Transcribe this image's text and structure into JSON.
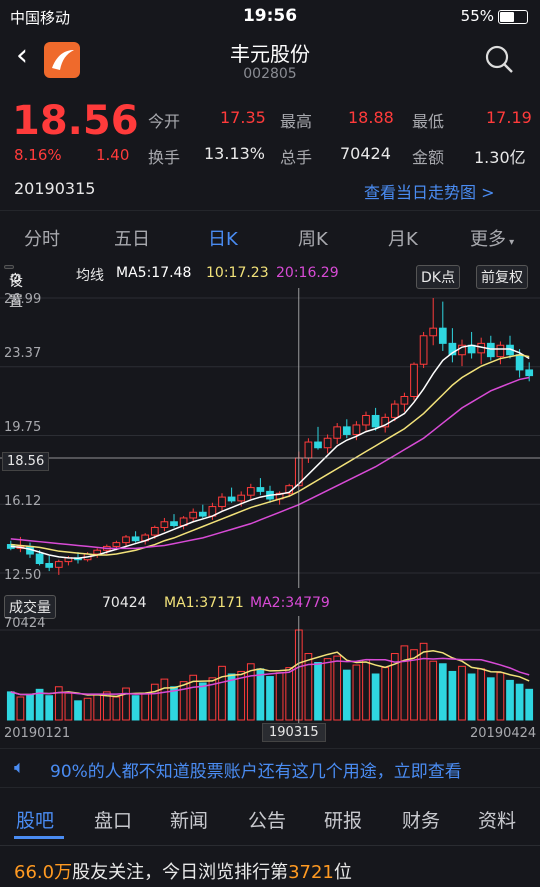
{
  "status": {
    "carrier": "中国移动",
    "time": "19:56",
    "battery": "55%"
  },
  "header": {
    "name": "丰元股份",
    "code": "002805"
  },
  "quote": {
    "price": "18.56",
    "change_pct": "8.16%",
    "change": "1.40",
    "date": "20190315",
    "open_label": "今开",
    "open": "17.35",
    "high_label": "最高",
    "high": "18.88",
    "low_label": "最低",
    "low": "17.19",
    "turnover_label": "换手",
    "turnover": "13.13%",
    "volume_label": "总手",
    "volume": "70424",
    "amount_label": "金额",
    "amount": "1.30亿",
    "link": "查看当日走势图 >"
  },
  "tabs": [
    "分时",
    "五日",
    "日K",
    "周K",
    "月K",
    "更多"
  ],
  "chart_toolbar": {
    "settings": "设置",
    "ma_label": "均线",
    "ma5": "MA5:17.48",
    "ma10": "10:17.23",
    "ma20": "20:16.29",
    "dk": "DK点",
    "adjust": "前复权"
  },
  "volume_toolbar": {
    "label": "成交量",
    "vol": "70424",
    "ma1": "MA1:37171",
    "ma2": "MA2:34779"
  },
  "colors": {
    "up": "#ff3b3b",
    "down": "#2fd6e0",
    "ma5": "#ffffff",
    "ma10": "#f2e27a",
    "ma20": "#d84bd6",
    "accent": "#4a8cf2"
  },
  "chart_data": {
    "type": "candlestick",
    "y_ticks": [
      "26.99",
      "23.37",
      "19.75",
      "16.12",
      "12.50"
    ],
    "ylim": [
      12.5,
      26.99
    ],
    "crosshair_value": "18.56",
    "crosshair_date": "190315",
    "x_start": "20190121",
    "x_end": "20190424",
    "volume_max": "70424",
    "candles": [
      {
        "o": 14.0,
        "h": 14.2,
        "l": 13.7,
        "c": 13.8
      },
      {
        "o": 13.8,
        "h": 14.4,
        "l": 13.6,
        "c": 13.9
      },
      {
        "o": 13.9,
        "h": 14.1,
        "l": 13.3,
        "c": 13.5
      },
      {
        "o": 13.5,
        "h": 13.7,
        "l": 12.9,
        "c": 13.0
      },
      {
        "o": 13.0,
        "h": 13.4,
        "l": 12.6,
        "c": 12.8
      },
      {
        "o": 12.8,
        "h": 13.2,
        "l": 12.4,
        "c": 13.1
      },
      {
        "o": 13.1,
        "h": 13.4,
        "l": 12.9,
        "c": 13.3
      },
      {
        "o": 13.3,
        "h": 13.6,
        "l": 13.0,
        "c": 13.2
      },
      {
        "o": 13.2,
        "h": 13.6,
        "l": 13.1,
        "c": 13.5
      },
      {
        "o": 13.5,
        "h": 13.8,
        "l": 13.3,
        "c": 13.7
      },
      {
        "o": 13.7,
        "h": 14.0,
        "l": 13.5,
        "c": 13.9
      },
      {
        "o": 13.9,
        "h": 14.2,
        "l": 13.7,
        "c": 14.1
      },
      {
        "o": 14.1,
        "h": 14.5,
        "l": 13.9,
        "c": 14.4
      },
      {
        "o": 14.4,
        "h": 14.7,
        "l": 14.1,
        "c": 14.2
      },
      {
        "o": 14.2,
        "h": 14.6,
        "l": 14.0,
        "c": 14.5
      },
      {
        "o": 14.5,
        "h": 15.0,
        "l": 14.3,
        "c": 14.9
      },
      {
        "o": 14.9,
        "h": 15.4,
        "l": 14.7,
        "c": 15.2
      },
      {
        "o": 15.2,
        "h": 15.6,
        "l": 14.9,
        "c": 15.0
      },
      {
        "o": 15.0,
        "h": 15.5,
        "l": 14.8,
        "c": 15.4
      },
      {
        "o": 15.4,
        "h": 15.9,
        "l": 15.2,
        "c": 15.7
      },
      {
        "o": 15.7,
        "h": 16.1,
        "l": 15.4,
        "c": 15.5
      },
      {
        "o": 15.5,
        "h": 16.2,
        "l": 15.3,
        "c": 16.0
      },
      {
        "o": 16.0,
        "h": 16.7,
        "l": 15.8,
        "c": 16.5
      },
      {
        "o": 16.5,
        "h": 17.0,
        "l": 16.2,
        "c": 16.3
      },
      {
        "o": 16.3,
        "h": 16.8,
        "l": 16.0,
        "c": 16.6
      },
      {
        "o": 16.6,
        "h": 17.2,
        "l": 16.4,
        "c": 17.0
      },
      {
        "o": 17.0,
        "h": 17.5,
        "l": 16.6,
        "c": 16.8
      },
      {
        "o": 16.8,
        "h": 17.1,
        "l": 16.2,
        "c": 16.4
      },
      {
        "o": 16.4,
        "h": 16.8,
        "l": 16.1,
        "c": 16.7
      },
      {
        "o": 16.7,
        "h": 17.2,
        "l": 16.5,
        "c": 17.1
      },
      {
        "o": 17.1,
        "h": 18.9,
        "l": 17.2,
        "c": 18.56
      },
      {
        "o": 18.56,
        "h": 19.6,
        "l": 18.3,
        "c": 19.4
      },
      {
        "o": 19.4,
        "h": 20.2,
        "l": 19.0,
        "c": 19.1
      },
      {
        "o": 19.1,
        "h": 19.8,
        "l": 18.8,
        "c": 19.6
      },
      {
        "o": 19.6,
        "h": 20.4,
        "l": 19.3,
        "c": 20.2
      },
      {
        "o": 20.2,
        "h": 20.6,
        "l": 19.6,
        "c": 19.8
      },
      {
        "o": 19.8,
        "h": 20.5,
        "l": 19.5,
        "c": 20.3
      },
      {
        "o": 20.3,
        "h": 21.0,
        "l": 20.0,
        "c": 20.8
      },
      {
        "o": 20.8,
        "h": 21.2,
        "l": 20.0,
        "c": 20.2
      },
      {
        "o": 20.2,
        "h": 20.9,
        "l": 19.9,
        "c": 20.7
      },
      {
        "o": 20.7,
        "h": 21.6,
        "l": 20.5,
        "c": 21.4
      },
      {
        "o": 21.4,
        "h": 22.0,
        "l": 21.0,
        "c": 21.8
      },
      {
        "o": 21.8,
        "h": 23.6,
        "l": 21.6,
        "c": 23.5
      },
      {
        "o": 23.5,
        "h": 25.2,
        "l": 23.3,
        "c": 25.0
      },
      {
        "o": 25.0,
        "h": 26.99,
        "l": 24.5,
        "c": 25.4
      },
      {
        "o": 25.4,
        "h": 26.8,
        "l": 24.2,
        "c": 24.6
      },
      {
        "o": 24.6,
        "h": 25.4,
        "l": 23.6,
        "c": 24.0
      },
      {
        "o": 24.0,
        "h": 24.8,
        "l": 23.4,
        "c": 24.5
      },
      {
        "o": 24.5,
        "h": 25.2,
        "l": 23.8,
        "c": 24.1
      },
      {
        "o": 24.1,
        "h": 24.9,
        "l": 23.5,
        "c": 24.6
      },
      {
        "o": 24.6,
        "h": 25.0,
        "l": 23.7,
        "c": 23.9
      },
      {
        "o": 23.9,
        "h": 24.7,
        "l": 23.5,
        "c": 24.5
      },
      {
        "o": 24.5,
        "h": 25.0,
        "l": 23.8,
        "c": 24.0
      },
      {
        "o": 24.0,
        "h": 24.3,
        "l": 22.8,
        "c": 23.2
      },
      {
        "o": 23.2,
        "h": 23.6,
        "l": 22.6,
        "c": 22.9
      }
    ],
    "volumes": [
      22000,
      18000,
      20000,
      24000,
      19000,
      26000,
      21000,
      15000,
      17000,
      20000,
      22000,
      18000,
      25000,
      19000,
      21000,
      28000,
      32000,
      26000,
      30000,
      35000,
      29000,
      33000,
      42000,
      36000,
      38000,
      44000,
      40000,
      34000,
      37000,
      41000,
      70424,
      52000,
      45000,
      48000,
      50000,
      39000,
      43000,
      47000,
      36000,
      41000,
      52000,
      58000,
      55000,
      60000,
      46000,
      44000,
      38000,
      42000,
      36000,
      40000,
      33000,
      37000,
      31000,
      28000,
      24000
    ],
    "ma5": [
      13.9,
      13.85,
      13.75,
      13.6,
      13.45,
      13.35,
      13.3,
      13.28,
      13.35,
      13.45,
      13.6,
      13.75,
      13.9,
      14.05,
      14.2,
      14.4,
      14.6,
      14.8,
      15.0,
      15.2,
      15.35,
      15.5,
      15.75,
      15.95,
      16.15,
      16.35,
      16.5,
      16.6,
      16.65,
      16.75,
      17.2,
      17.7,
      18.2,
      18.7,
      19.2,
      19.5,
      19.7,
      19.95,
      20.1,
      20.3,
      20.6,
      20.9,
      21.5,
      22.2,
      23.0,
      23.7,
      24.1,
      24.4,
      24.5,
      24.4,
      24.3,
      24.3,
      24.3,
      24.1,
      23.8
    ],
    "ma10": [
      14.0,
      13.95,
      13.9,
      13.85,
      13.75,
      13.65,
      13.6,
      13.55,
      13.5,
      13.45,
      13.45,
      13.5,
      13.6,
      13.7,
      13.85,
      14.0,
      14.2,
      14.35,
      14.55,
      14.75,
      14.95,
      15.15,
      15.35,
      15.55,
      15.75,
      15.95,
      16.1,
      16.25,
      16.4,
      16.55,
      16.8,
      17.1,
      17.4,
      17.7,
      18.0,
      18.3,
      18.6,
      18.9,
      19.2,
      19.5,
      19.8,
      20.1,
      20.5,
      20.9,
      21.4,
      21.9,
      22.4,
      22.8,
      23.1,
      23.4,
      23.6,
      23.8,
      23.9,
      24.0,
      23.9
    ],
    "ma20": [
      14.3,
      14.25,
      14.2,
      14.15,
      14.1,
      14.05,
      14.0,
      13.95,
      13.9,
      13.85,
      13.8,
      13.8,
      13.8,
      13.8,
      13.85,
      13.9,
      13.95,
      14.05,
      14.15,
      14.25,
      14.35,
      14.5,
      14.65,
      14.8,
      14.95,
      15.1,
      15.3,
      15.5,
      15.7,
      15.9,
      16.1,
      16.35,
      16.6,
      16.85,
      17.1,
      17.35,
      17.6,
      17.85,
      18.1,
      18.4,
      18.7,
      19.0,
      19.3,
      19.6,
      20.0,
      20.4,
      20.8,
      21.2,
      21.5,
      21.8,
      22.1,
      22.3,
      22.5,
      22.7,
      22.8
    ]
  },
  "ad": "90%的人都不知道股票账户还有这几个用途，立即查看",
  "bottom_tabs": [
    "股吧",
    "盘口",
    "新闻",
    "公告",
    "研报",
    "财务",
    "资料"
  ],
  "footer": {
    "followers": "66.0万",
    "text1": "股友关注，今日浏览排行第",
    "rank": "3721",
    "text2": "位"
  }
}
